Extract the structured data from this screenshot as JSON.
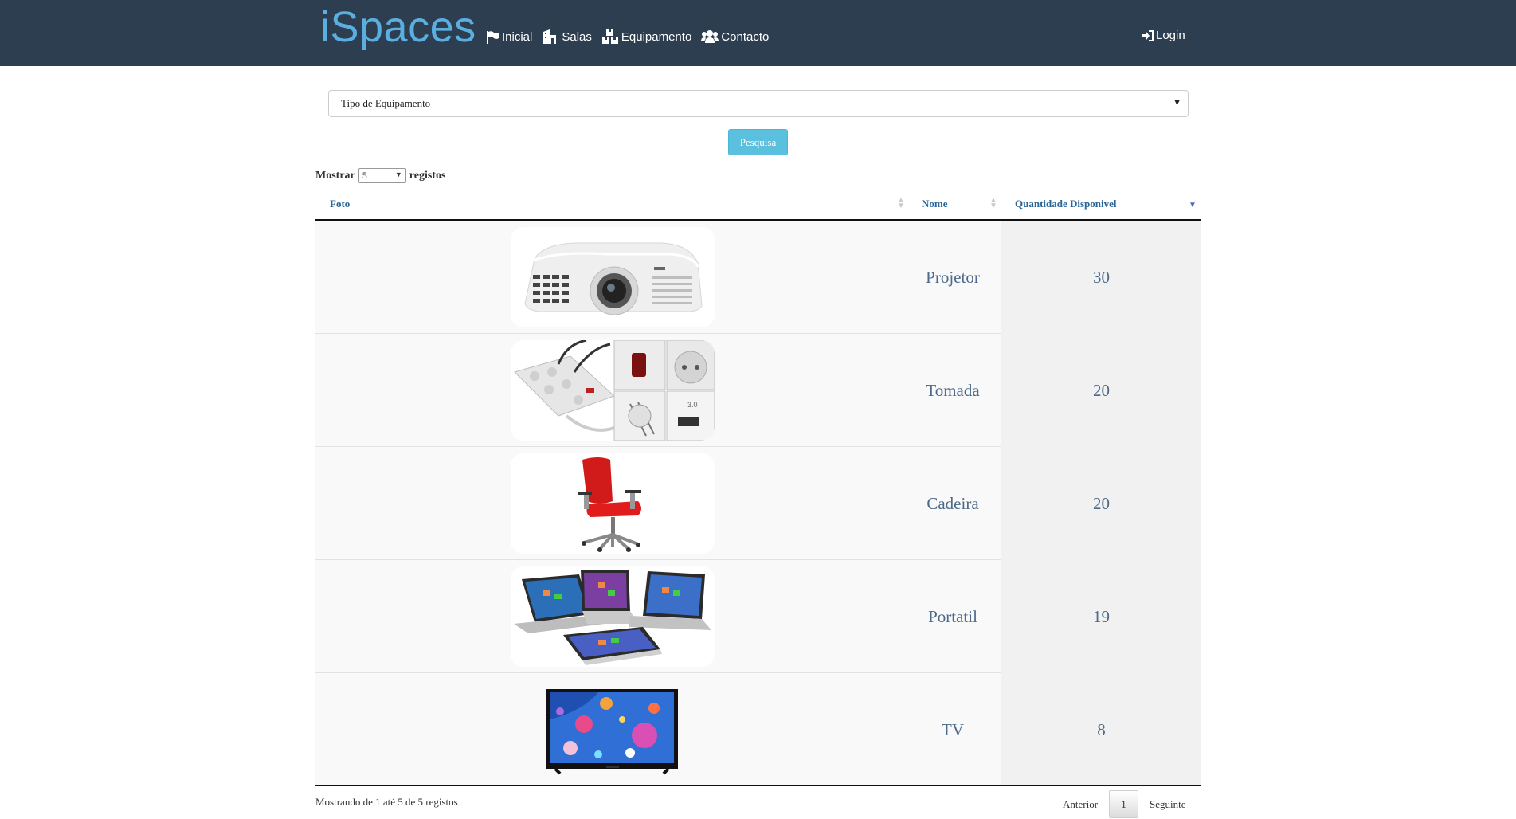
{
  "header": {
    "brand": "iSpaces",
    "nav": [
      {
        "label": "Inicial",
        "icon": "flag-icon"
      },
      {
        "label": "Salas",
        "icon": "building-icon"
      },
      {
        "label": "Equipamento",
        "icon": "cubes-icon"
      },
      {
        "label": "Contacto",
        "icon": "users-icon"
      }
    ],
    "login": {
      "label": "Login",
      "icon": "sign-in-icon"
    }
  },
  "filter": {
    "select_value": "Tipo de Equipamento",
    "search_label": "Pesquisa"
  },
  "length": {
    "prefix": "Mostrar",
    "value": "5",
    "suffix": "registos"
  },
  "table": {
    "columns": [
      "Foto",
      "Nome",
      "Quantidade Disponivel"
    ],
    "sorted_column": "Quantidade Disponivel",
    "sort_direction": "desc",
    "rows": [
      {
        "photo": "projector-image",
        "name": "Projetor",
        "qty": "30"
      },
      {
        "photo": "power-strip-image",
        "name": "Tomada",
        "qty": "20"
      },
      {
        "photo": "office-chair-image",
        "name": "Cadeira",
        "qty": "20"
      },
      {
        "photo": "laptops-image",
        "name": "Portatil",
        "qty": "19"
      },
      {
        "photo": "tv-image",
        "name": "TV",
        "qty": "8"
      }
    ]
  },
  "footer": {
    "info": "Mostrando de 1 até 5 de 5 registos",
    "previous": "Anterior",
    "current_page": "1",
    "next": "Seguinte"
  },
  "colors": {
    "navbar": "#2c3e50",
    "brand": "#5aaee0",
    "button": "#5bc0de",
    "header_link": "#2a6496"
  }
}
